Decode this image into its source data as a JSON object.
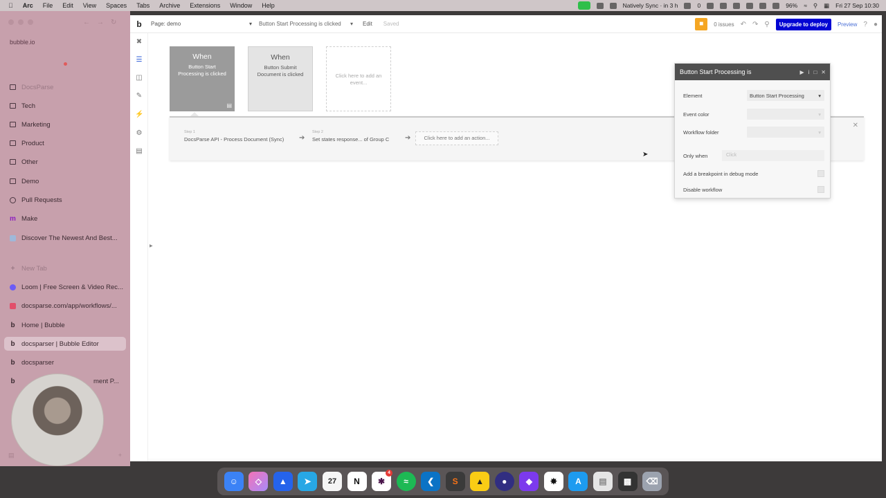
{
  "menubar": {
    "app": "Arc",
    "items": [
      "File",
      "Edit",
      "View",
      "Spaces",
      "Tabs",
      "Archive",
      "Extensions",
      "Window",
      "Help"
    ],
    "sync": "Natively Sync · in 3 h",
    "count": "0",
    "battery": "96%",
    "datetime": "Fri 27 Sep  10:30"
  },
  "sidebar": {
    "url": "bubble.io",
    "folders": [
      "DocsParse",
      "Tech",
      "Marketing",
      "Product",
      "Other",
      "Demo"
    ],
    "pinned": [
      {
        "label": "Pull Requests"
      },
      {
        "label": "Make"
      },
      {
        "label": "Discover The Newest And Best..."
      }
    ],
    "new_tab": "New Tab",
    "tabs": [
      {
        "label": "Loom | Free Screen & Video Rec..."
      },
      {
        "label": "docsparse.com/app/workflows/..."
      },
      {
        "label": "Home | Bubble"
      },
      {
        "label": "docsparser | Bubble Editor"
      },
      {
        "label": "docsparser"
      }
    ],
    "partial_tab_tail": "ment P..."
  },
  "editor": {
    "page_label": "Page: demo",
    "workflow_selector": "Button Start Processing is clicked",
    "edit_label": "Edit",
    "saved_label": "Saved",
    "issues": "0 issues",
    "upgrade_label": "Upgrade to deploy",
    "preview_label": "Preview"
  },
  "events": [
    {
      "when": "When",
      "desc": "Button Start Processing is clicked"
    },
    {
      "when": "When",
      "desc": "Button Submit Document is clicked"
    }
  ],
  "add_event": "Click here to add an event...",
  "steps": [
    {
      "no": "Step 1",
      "label": "DocsParse API - Process Document (Sync)"
    },
    {
      "no": "Step 2",
      "label": "Set states response... of Group C"
    }
  ],
  "add_action": "Click here to add an action...",
  "panel": {
    "title": "Button Start Processing is",
    "element_label": "Element",
    "element_value": "Button Start Processing",
    "event_color_label": "Event color",
    "workflow_folder_label": "Workflow folder",
    "only_when_label": "Only when",
    "only_when_placeholder": "Click",
    "breakpoint_label": "Add a breakpoint in debug mode",
    "disable_label": "Disable workflow"
  },
  "dock": {
    "calendar_day": "27",
    "slack_badge": "4"
  }
}
